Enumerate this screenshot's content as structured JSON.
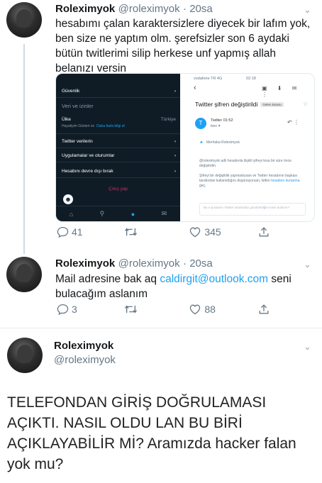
{
  "tweets": [
    {
      "name": "Roleximyok",
      "handle": "@roleximyok",
      "time": "· 20sa",
      "text": "hesabımı çalan karaktersizlere diyecek bir lafım yok, ben size ne yaptım olm. şerefsizler son 6 aydaki bütün twitlerimi silip herkese unf yapmış allah belanızı versin",
      "replies": "41",
      "likes": "345"
    },
    {
      "name": "Roleximyok",
      "handle": "@roleximyok",
      "time": "· 20sa",
      "text_before": "Mail adresine bak aq ",
      "email": "caldirgit@outlook.com",
      "text_after": " seni bulacağım aslanım",
      "replies": "3",
      "likes": "88"
    },
    {
      "name": "Roleximyok",
      "handle": "@roleximyok",
      "text": "TELEFONDAN GİRİŞ DOĞRULAMASI AÇIKTI. NASIL OLDU LAN BU BİRİ AÇIKLAYABİLİR Mİ? Aramızda hacker falan yok mu?"
    }
  ],
  "media": {
    "settings": {
      "security": "Güvenlik",
      "data_header": "Veri ve izinler",
      "country_label": "Ülke",
      "country_value": "Türkiye",
      "country_sub": "Hayatiyim Gösteri ve",
      "country_link": "Daha fazla bilgi al",
      "twitter_data": "Twitter verilerin",
      "apps": "Uygulamalar ve oturumlar",
      "deactivate": "Hesabını devre dışı bırak",
      "logout": "Çıkış yap"
    },
    "mail": {
      "carrier": "vodafone TR 4G",
      "clock": "02:18",
      "subject": "Twitter şifren değiştirildi",
      "badge": "Gelen kutusu",
      "sender": "Twitter",
      "sender_time": "01:52",
      "recipient": "ben ▾",
      "greeting": "Merhaba Roleximyok",
      "body1": "@roleximyok adlı hesabınla ilişkili şifreyi kısa bir süre önce değiştirdin.",
      "body2": "Şifreyi bir değişiklik yapmadıysan ve Twitter hesabının başkası tarafından kullanıldığını düşünüyorsan, lütfen",
      "body_link": "hesabını kurtarma",
      "body_end": "geç.",
      "reply_box": "Bu e-postanın Twitter tarafından gönderildiğini nasıl anlarım?"
    }
  },
  "colors": {
    "link": "#1da1f2",
    "muted": "#657786"
  }
}
